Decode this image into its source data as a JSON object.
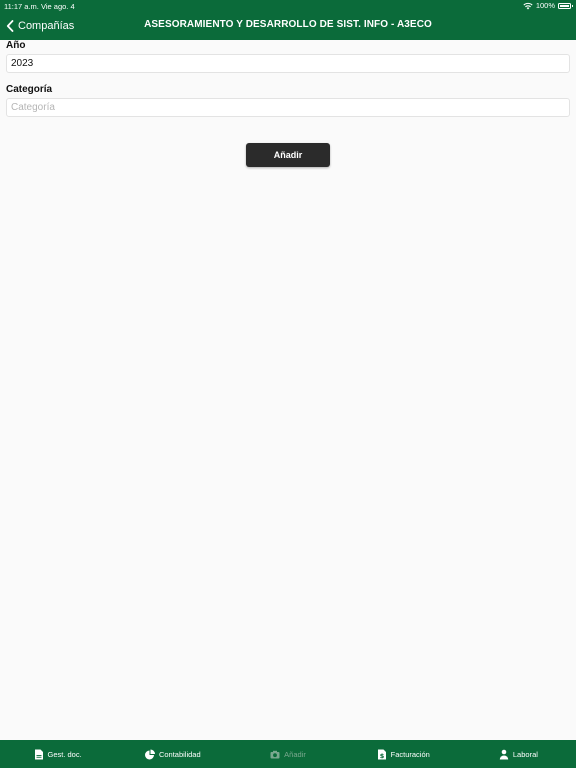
{
  "status": {
    "time": "11:17 a.m.",
    "date": "Vie ago. 4",
    "battery": "100%"
  },
  "nav": {
    "back_label": "Compañías",
    "title": "ASESORAMIENTO Y DESARROLLO DE SIST. INFO - A3ECO"
  },
  "form": {
    "year_label": "Año",
    "year_value": "2023",
    "category_label": "Categoría",
    "category_placeholder": "Categoría",
    "add_button": "Añadir"
  },
  "tabs": [
    {
      "label": "Gest. doc.",
      "icon": "document-icon",
      "enabled": true
    },
    {
      "label": "Contabilidad",
      "icon": "pie-chart-icon",
      "enabled": true
    },
    {
      "label": "Añadir",
      "icon": "camera-icon",
      "enabled": false
    },
    {
      "label": "Facturación",
      "icon": "invoice-icon",
      "enabled": true
    },
    {
      "label": "Laboral",
      "icon": "person-icon",
      "enabled": true
    }
  ],
  "colors": {
    "brand_green": "#0b6b3a",
    "button_dark": "#2b2b2b"
  }
}
